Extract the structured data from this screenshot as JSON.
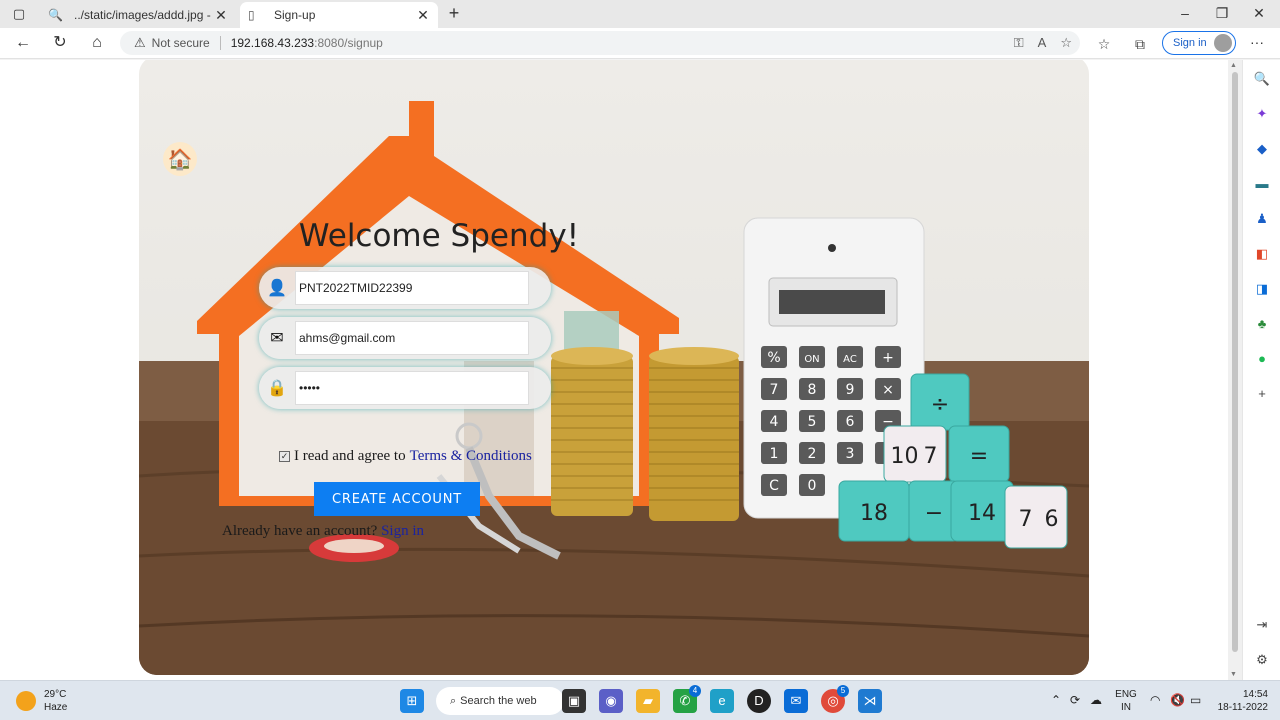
{
  "browser": {
    "tabs": [
      {
        "label": "../static/images/addd.jpg - Search",
        "active": false
      },
      {
        "label": "Sign-up",
        "active": true
      }
    ],
    "address": {
      "security_label": "Not secure",
      "host": "192.168.43.233",
      "path": ":8080/signup"
    },
    "signin_label": "Sign in"
  },
  "page": {
    "title": "Welcome Spendy!",
    "fields": {
      "username_value": "PNT2022TMID22399",
      "email_value": "ahms@gmail.com",
      "password_value": "•••••"
    },
    "agree_text": "I read and agree to",
    "terms_link": "Terms & Conditions",
    "create_button": "CREATE ACCOUNT",
    "already_text": "Already have an account?",
    "signin_link": "Sign in"
  },
  "calculator_keys": [
    "%",
    "ON",
    "AC",
    "+",
    "7",
    "8",
    "9",
    "×",
    "4",
    "5",
    "6",
    "−",
    "1",
    "2",
    "3",
    "+",
    "C",
    "0"
  ],
  "dice_labels": [
    "÷",
    "10",
    "7",
    "=",
    "18",
    "−",
    "14",
    "7",
    "6"
  ],
  "taskbar": {
    "weather_temp": "29°C",
    "weather_desc": "Haze",
    "search_label": "Search the web",
    "lang_top": "ENG",
    "lang_bottom": "IN",
    "time": "14:54",
    "date": "18-11-2022",
    "whatsapp_badge": "4",
    "chrome_badge": "5"
  },
  "colors": {
    "accent": "#0d7ef2",
    "house_orange": "#f46f22",
    "link": "#1a23a0"
  }
}
